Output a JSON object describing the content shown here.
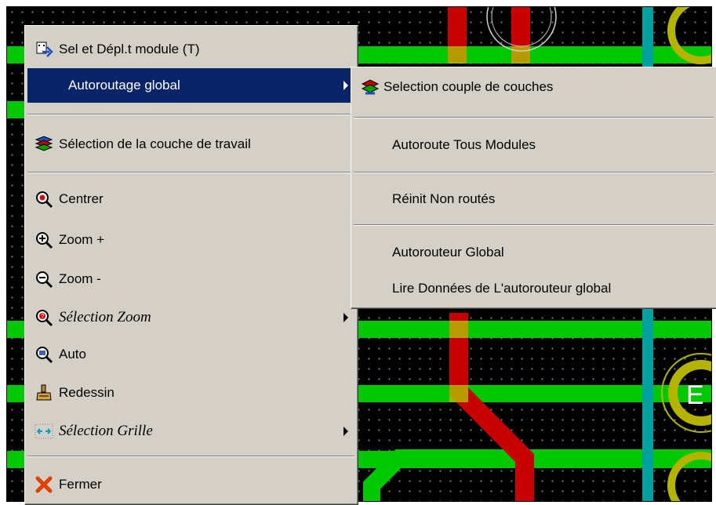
{
  "context_menu": {
    "items": [
      {
        "label": "Sel et Dépl.t module (T)",
        "icon": "move-module-icon"
      },
      {
        "label": "Autoroutage global",
        "submenu": true,
        "highlighted": true
      },
      {
        "label": "Sélection de la couche de travail",
        "icon": "layers-icon"
      },
      {
        "label": "Centrer",
        "icon": "center-zoom-icon"
      },
      {
        "label": "Zoom +",
        "icon": "zoom-in-icon"
      },
      {
        "label": "Zoom -",
        "icon": "zoom-out-icon"
      },
      {
        "label": "Sélection Zoom",
        "icon": "zoom-select-icon",
        "submenu": true
      },
      {
        "label": "Auto",
        "icon": "zoom-auto-icon"
      },
      {
        "label": "Redessin",
        "icon": "redraw-brush-icon"
      },
      {
        "label": "Sélection Grille",
        "icon": "grid-icon",
        "submenu": true
      },
      {
        "label": "Fermer",
        "icon": "close-icon"
      }
    ]
  },
  "submenu": {
    "items": [
      {
        "label": "Selection couple de couches",
        "icon": "layer-pair-icon"
      },
      {
        "label": "Autoroute Tous Modules"
      },
      {
        "label": "Réinit Non routés"
      },
      {
        "label": "Autorouteur Global"
      },
      {
        "label": "Lire Données de L'autorouteur global"
      }
    ]
  },
  "pcb_label": "E",
  "colors": {
    "menu_bg": "#d4d0c8",
    "highlight": "#0a246a",
    "track_green": "#00c800",
    "track_red": "#c80000",
    "track_cyan": "#00a0a0",
    "pad_yellow": "#c8c800"
  }
}
